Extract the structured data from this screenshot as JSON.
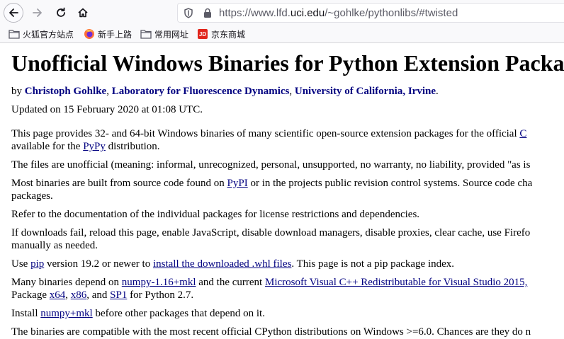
{
  "browser": {
    "url_prefix": "https://www.lfd.",
    "url_domain": "uci.edu",
    "url_suffix": "/~gohlke/pythonlibs/#twisted"
  },
  "bookmarks": [
    {
      "label": "火狐官方站点",
      "icon": "folder-icon"
    },
    {
      "label": "新手上路",
      "icon": "firefox-icon"
    },
    {
      "label": "常用网址",
      "icon": "folder-icon"
    },
    {
      "label": "京东商城",
      "icon": "jd-icon",
      "icon_text": "JD"
    }
  ],
  "page": {
    "title": "Unofficial Windows Binaries for Python Extension Packa",
    "byline": {
      "by": "by ",
      "author": "Christoph Gohlke",
      "sep1": ", ",
      "lab": "Laboratory for Fluorescence Dynamics",
      "sep2": ", ",
      "univ": "University of California, Irvine",
      "end": "."
    },
    "updated": "Updated on 15 February 2020 at 01:08 UTC.",
    "p1_line1_a": "This page provides 32- and 64-bit Windows binaries of many scientific open-source extension packages for the official ",
    "p1_line1_link": "C",
    "p1_line2_a": "available for the ",
    "p1_line2_link": "PyPy",
    "p1_line2_b": " distribution.",
    "p2": "The files are unofficial (meaning: informal, unrecognized, personal, unsupported, no warranty, no liability, provided \"as is",
    "p3_line1_a": "Most binaries are built from source code found on ",
    "p3_line1_link": "PyPI",
    "p3_line1_b": " or in the projects public revision control systems. Source code cha",
    "p3_line2": "packages.",
    "p4": "Refer to the documentation of the individual packages for license restrictions and dependencies.",
    "p5_line1": "If downloads fail, reload this page, enable JavaScript, disable download managers, disable proxies, clear cache, use Firefo",
    "p5_line2": "manually as needed.",
    "p6_a": "Use ",
    "p6_link1": "pip",
    "p6_b": " version 19.2 or newer to ",
    "p6_link2": "install the downloaded .whl files",
    "p6_c": ". This page is not a pip package index.",
    "p7_line1_a": "Many binaries depend on ",
    "p7_line1_link1": "numpy-1.16+mkl",
    "p7_line1_b": " and the current ",
    "p7_line1_link2": "Microsoft Visual C++ Redistributable for Visual Studio 2015, ",
    "p7_line2_a": "Package ",
    "p7_line2_link1": "x64",
    "p7_line2_sep1": ", ",
    "p7_line2_link2": "x86",
    "p7_line2_sep2": ", and ",
    "p7_line2_link3": "SP1",
    "p7_line2_b": " for Python 2.7.",
    "p8_a": "Install ",
    "p8_link": "numpy+mkl",
    "p8_b": " before other packages that depend on it.",
    "p9": "The binaries are compatible with the most recent official CPython distributions on Windows >=6.0. Chances are they do n"
  }
}
